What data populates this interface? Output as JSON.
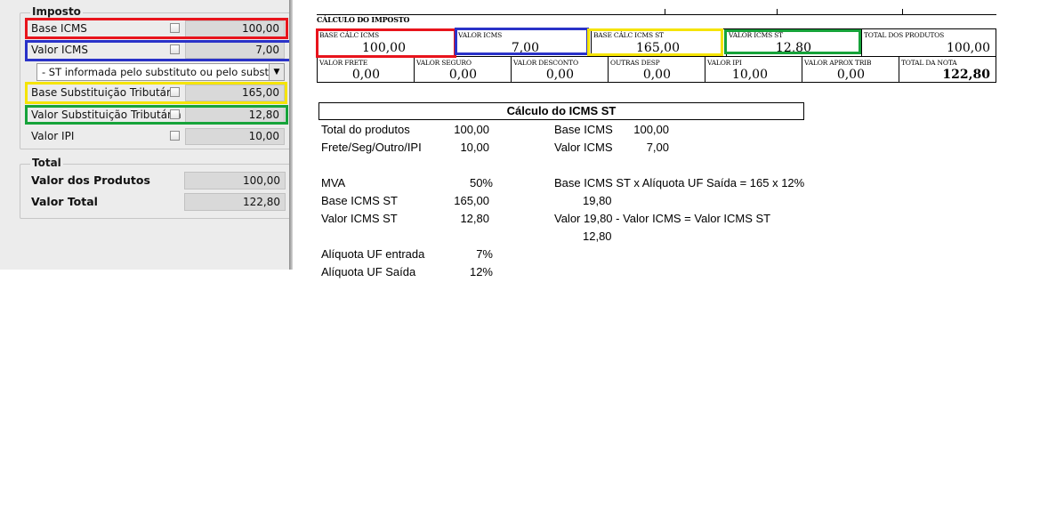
{
  "left_panel": {
    "imposto_title": "Imposto",
    "fields": [
      {
        "label": "Base ICMS",
        "value": "100,00"
      },
      {
        "label": "Valor ICMS",
        "value": "7,00"
      },
      {
        "label": "Base Substituição Tributária",
        "value": "165,00"
      },
      {
        "label": "Valor Substituição Tributária",
        "value": "12,80"
      },
      {
        "label": "Valor IPI",
        "value": "10,00"
      }
    ],
    "st_select": "- ST informada pelo substituto ou pelo substituído",
    "total_title": "Total",
    "totals": [
      {
        "label": "Valor dos Produtos",
        "value": "100,00"
      },
      {
        "label": "Valor Total",
        "value": "122,80"
      }
    ],
    "highlight_colors": {
      "red": "#e8141c",
      "blue": "#2a32c8",
      "yellow": "#f5e400",
      "green": "#16a33a"
    }
  },
  "danfe": {
    "title": "CÁLCULO DO IMPOSTO",
    "row1": [
      {
        "label": "BASE CÁLC ICMS",
        "value": "100,00"
      },
      {
        "label": "VALOR ICMS",
        "value": "7,00"
      },
      {
        "label": "BASE CÁLC ICMS ST",
        "value": "165,00"
      },
      {
        "label": "VALOR ICMS ST",
        "value": "12,80"
      },
      {
        "label": "TOTAL DOS PRODUTOS",
        "value": "100,00"
      }
    ],
    "row2": [
      {
        "label": "VALOR FRETE",
        "value": "0,00"
      },
      {
        "label": "VALOR SEGURO",
        "value": "0,00"
      },
      {
        "label": "VALOR DESCONTO",
        "value": "0,00"
      },
      {
        "label": "OUTRAS DESP",
        "value": "0,00"
      },
      {
        "label": "VALOR IPI",
        "value": "10,00"
      },
      {
        "label": "VALOR APROX TRIB",
        "value": "0,00"
      },
      {
        "label": "TOTAL DA NOTA",
        "value": "122,80"
      }
    ]
  },
  "calc": {
    "title": "Cálculo do ICMS ST",
    "total_produtos_label": "Total do produtos",
    "total_produtos_value": "100,00",
    "frete_label": "Frete/Seg/Outro/IPI",
    "frete_value": "10,00",
    "base_icms_label": "Base ICMS",
    "base_icms_value": "100,00",
    "valor_icms_label": "Valor ICMS",
    "valor_icms_value": "7,00",
    "mva_label": "MVA",
    "mva_value": "50%",
    "base_icms_st_label": "Base ICMS ST",
    "base_icms_st_value": "165,00",
    "valor_icms_st_label": "Valor ICMS ST",
    "valor_icms_st_value": "12,80",
    "formula1": "Base ICMS ST x Alíquota UF Saída = 165 x 12%",
    "formula1_result": "19,80",
    "formula2": "Valor 19,80 - Valor ICMS = Valor ICMS ST",
    "formula2_result": "12,80",
    "aliq_entrada_label": "Alíquota UF entrada",
    "aliq_entrada_value": "7%",
    "aliq_saida_label": "Alíquota UF Saída",
    "aliq_saida_value": "12%"
  }
}
